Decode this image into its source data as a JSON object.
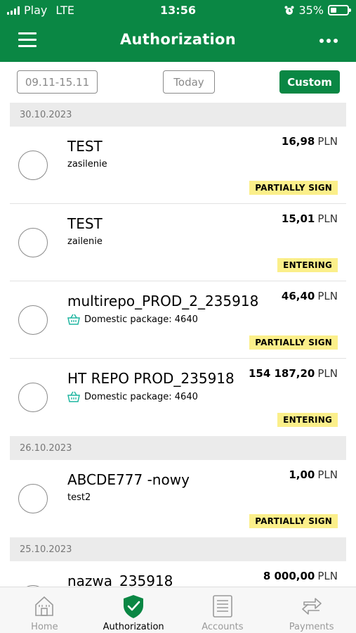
{
  "status_bar": {
    "carrier": "Play",
    "network": "LTE",
    "time": "13:56",
    "battery": "35%",
    "battery_level": 0.35
  },
  "header": {
    "title": "Authorization"
  },
  "filters": {
    "range": "09.11-15.11",
    "today": "Today",
    "custom": "Custom"
  },
  "groups": [
    {
      "date": "30.10.2023",
      "items": [
        {
          "name": "TEST",
          "sub": "zasilenie",
          "icon": "",
          "amount": "16,98",
          "currency": "PLN",
          "status": "PARTIALLY SIGN"
        },
        {
          "name": "TEST",
          "sub": "zailenie",
          "icon": "",
          "amount": "15,01",
          "currency": "PLN",
          "status": "ENTERING"
        },
        {
          "name": "multirepo_PROD_2_235918",
          "sub": "Domestic package: 4640",
          "icon": "basket-icon",
          "amount": "46,40",
          "currency": "PLN",
          "status": "PARTIALLY SIGN"
        },
        {
          "name": "HT REPO PROD_235918",
          "sub": "Domestic package: 4640",
          "icon": "basket-icon",
          "amount": "154 187,20",
          "currency": "PLN",
          "status": "ENTERING"
        }
      ]
    },
    {
      "date": "26.10.2023",
      "items": [
        {
          "name": "ABCDE777  -nowy",
          "sub": "test2",
          "icon": "",
          "amount": "1,00",
          "currency": "PLN",
          "status": "PARTIALLY SIGN"
        }
      ]
    },
    {
      "date": "25.10.2023",
      "items": [
        {
          "name": "nazwa_235918",
          "sub": "",
          "icon": "",
          "amount": "8 000,00",
          "currency": "PLN",
          "status": ""
        }
      ]
    }
  ],
  "nav": [
    {
      "label": "Home",
      "icon": "home-icon",
      "active": false
    },
    {
      "label": "Authorization",
      "icon": "shield-check-icon",
      "active": true
    },
    {
      "label": "Accounts",
      "icon": "accounts-icon",
      "active": false
    },
    {
      "label": "Payments",
      "icon": "payments-icon",
      "active": false
    }
  ],
  "colors": {
    "brand": "#0a8744",
    "status_badge": "#fbef8a",
    "date_header": "#ebebeb"
  }
}
